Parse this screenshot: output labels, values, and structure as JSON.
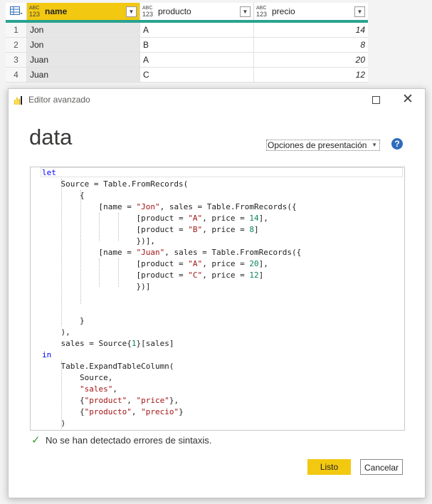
{
  "grid": {
    "columns": [
      {
        "type_top": "ABC",
        "type_bottom": "123",
        "name": "name"
      },
      {
        "type_top": "ABC",
        "type_bottom": "123",
        "name": "producto"
      },
      {
        "type_top": "ABC",
        "type_bottom": "123",
        "name": "precio"
      }
    ],
    "rows": [
      {
        "index": "1",
        "name": "Jon",
        "producto": "A",
        "precio": "14"
      },
      {
        "index": "2",
        "name": "Jon",
        "producto": "B",
        "precio": "8"
      },
      {
        "index": "3",
        "name": "Juan",
        "producto": "A",
        "precio": "20"
      },
      {
        "index": "4",
        "name": "Juan",
        "producto": "C",
        "precio": "12"
      }
    ]
  },
  "dialog": {
    "title": "Editor avanzado",
    "query_name": "data",
    "display_options_label": "Opciones de presentación",
    "help_label": "?",
    "close_label": "✕",
    "status_text": "No se han detectado errores de sintaxis.",
    "ok_label": "Listo",
    "cancel_label": "Cancelar",
    "code_lines": [
      "let",
      "    Source = Table.FromRecords(",
      "        {",
      "            [name = \"Jon\", sales = Table.FromRecords({",
      "                    [product = \"A\", price = 14],",
      "                    [product = \"B\", price = 8]",
      "                    })],",
      "            [name = \"Juan\", sales = Table.FromRecords({",
      "                    [product = \"A\", price = 20],",
      "                    [product = \"C\", price = 12]",
      "                    })]",
      "",
      "",
      "        }",
      "    ),",
      "    sales = Source{1}[sales]",
      "in",
      "    Table.ExpandTableColumn(",
      "        Source,",
      "        \"sales\",",
      "        {\"product\", \"price\"},",
      "        {\"producto\", \"precio\"}",
      "    )"
    ]
  },
  "colors": {
    "accent_yellow": "#f2c811",
    "header_teal": "#2aa38f",
    "keyword_blue": "#0000ff",
    "string_red": "#a31515",
    "number_green": "#098658"
  }
}
